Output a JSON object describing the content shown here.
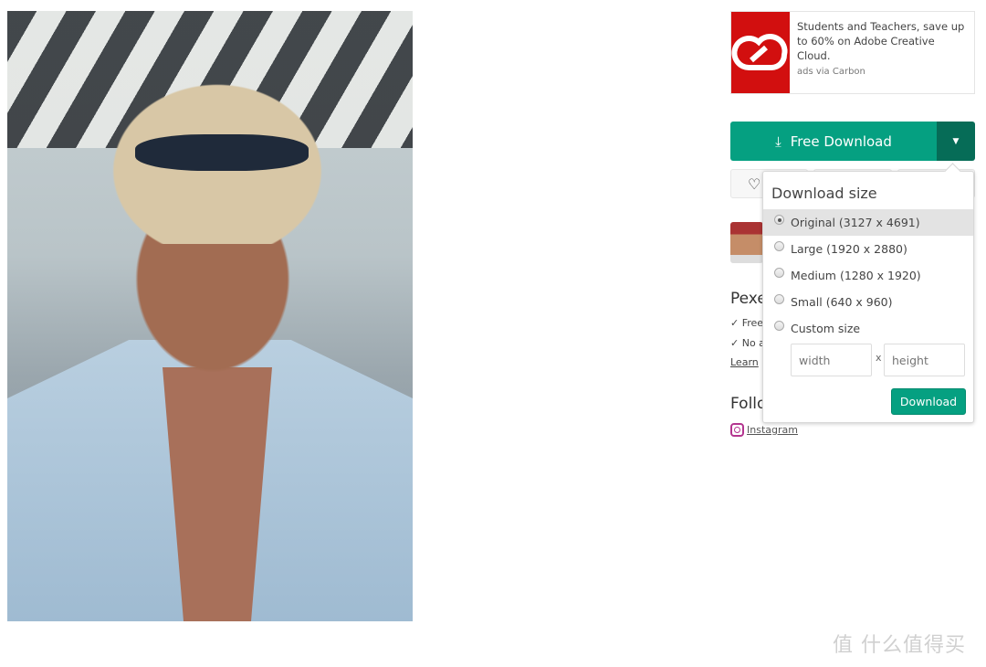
{
  "ad": {
    "text": "Students and Teachers, save up to 60% on Adobe Creative Cloud.",
    "via": "ads via Carbon",
    "brand_color": "#d20f0f"
  },
  "download": {
    "label": "Free Download",
    "accent": "#05a081",
    "caret_color": "#066c57"
  },
  "sidebar": {
    "pexels_heading": "Pexe",
    "free_line": "✓ Free",
    "no_line": "✓ No a",
    "learn": "Learn",
    "follow_heading": "Follo",
    "instagram": "Instagram"
  },
  "popup": {
    "title": "Download size",
    "options": [
      {
        "label": "Original (3127 x 4691)",
        "selected": true
      },
      {
        "label": "Large (1920 x 2880)"
      },
      {
        "label": "Medium (1280 x 1920)"
      },
      {
        "label": "Small (640 x 960)"
      },
      {
        "label": "Custom size"
      }
    ],
    "width_placeholder": "width",
    "height_placeholder": "height",
    "x": "x",
    "button": "Download"
  },
  "watermark": "值 什么值得买"
}
